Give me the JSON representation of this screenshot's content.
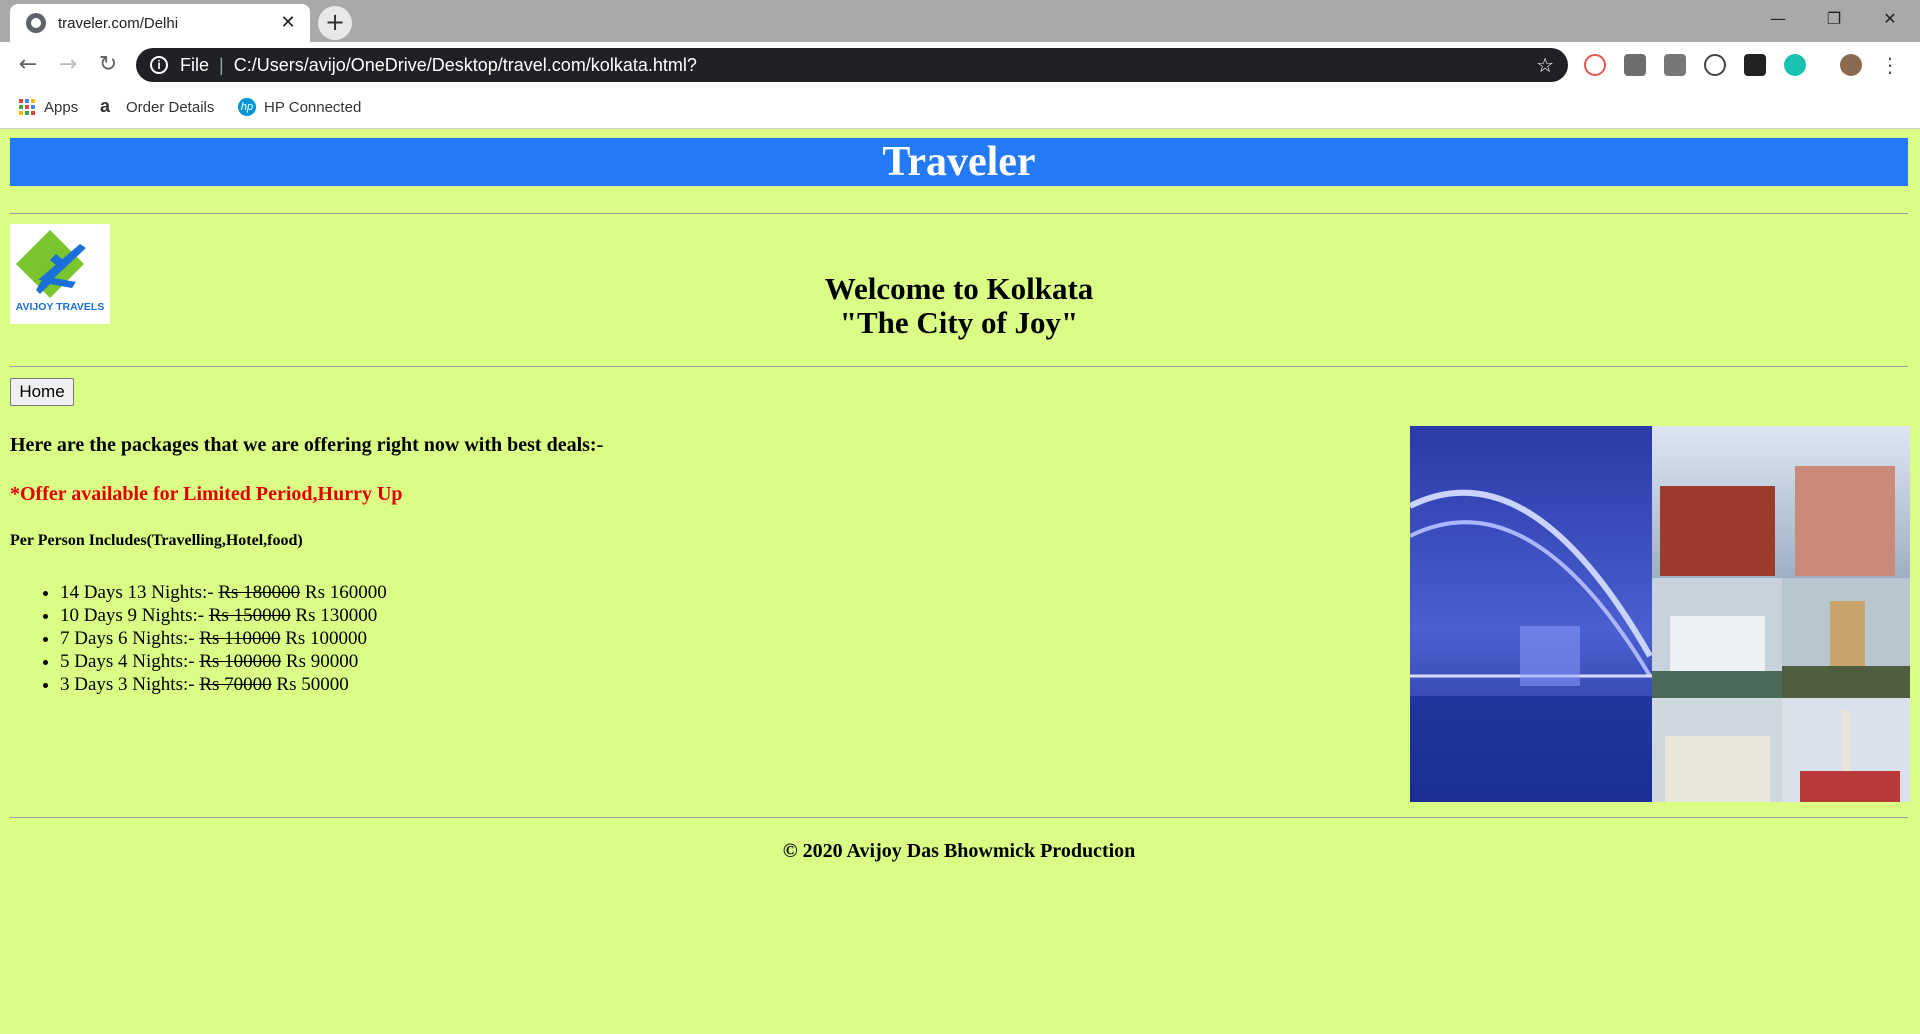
{
  "browser": {
    "tab_title": "traveler.com/Delhi",
    "scheme_label": "File",
    "url": "C:/Users/avijo/OneDrive/Desktop/travel.com/kolkata.html?",
    "bookmarks": [
      "Apps",
      "Order Details",
      "HP Connected"
    ]
  },
  "page": {
    "banner_title": "Traveler",
    "logo_text": "AVIJOY TRAVELS",
    "welcome_line1": "Welcome to Kolkata",
    "welcome_line2": "\"The City of Joy\"",
    "home_button": "Home",
    "intro": "Here are the packages that we are offering right now with best deals:-",
    "offer": "*Offer available for Limited Period,Hurry Up",
    "includes": "Per Person Includes(Travelling,Hotel,food)",
    "packages": [
      {
        "label": "14 Days 13 Nights:-",
        "old_price": "Rs 180000",
        "new_price": "Rs 160000"
      },
      {
        "label": "10 Days 9 Nights:-",
        "old_price": "Rs 150000",
        "new_price": "Rs 130000"
      },
      {
        "label": "7 Days 6 Nights:-",
        "old_price": "Rs 110000",
        "new_price": "Rs 100000"
      },
      {
        "label": "5 Days 4 Nights:-",
        "old_price": "Rs 100000",
        "new_price": "Rs 90000"
      },
      {
        "label": "3 Days 3 Nights:-",
        "old_price": "Rs 70000",
        "new_price": "Rs 50000"
      }
    ],
    "footer": "© 2020 Avijoy Das Bhowmick Production"
  },
  "colors": {
    "page_bg": "#d9fd85",
    "banner_bg": "#2479f6",
    "offer_text": "#e10000"
  }
}
